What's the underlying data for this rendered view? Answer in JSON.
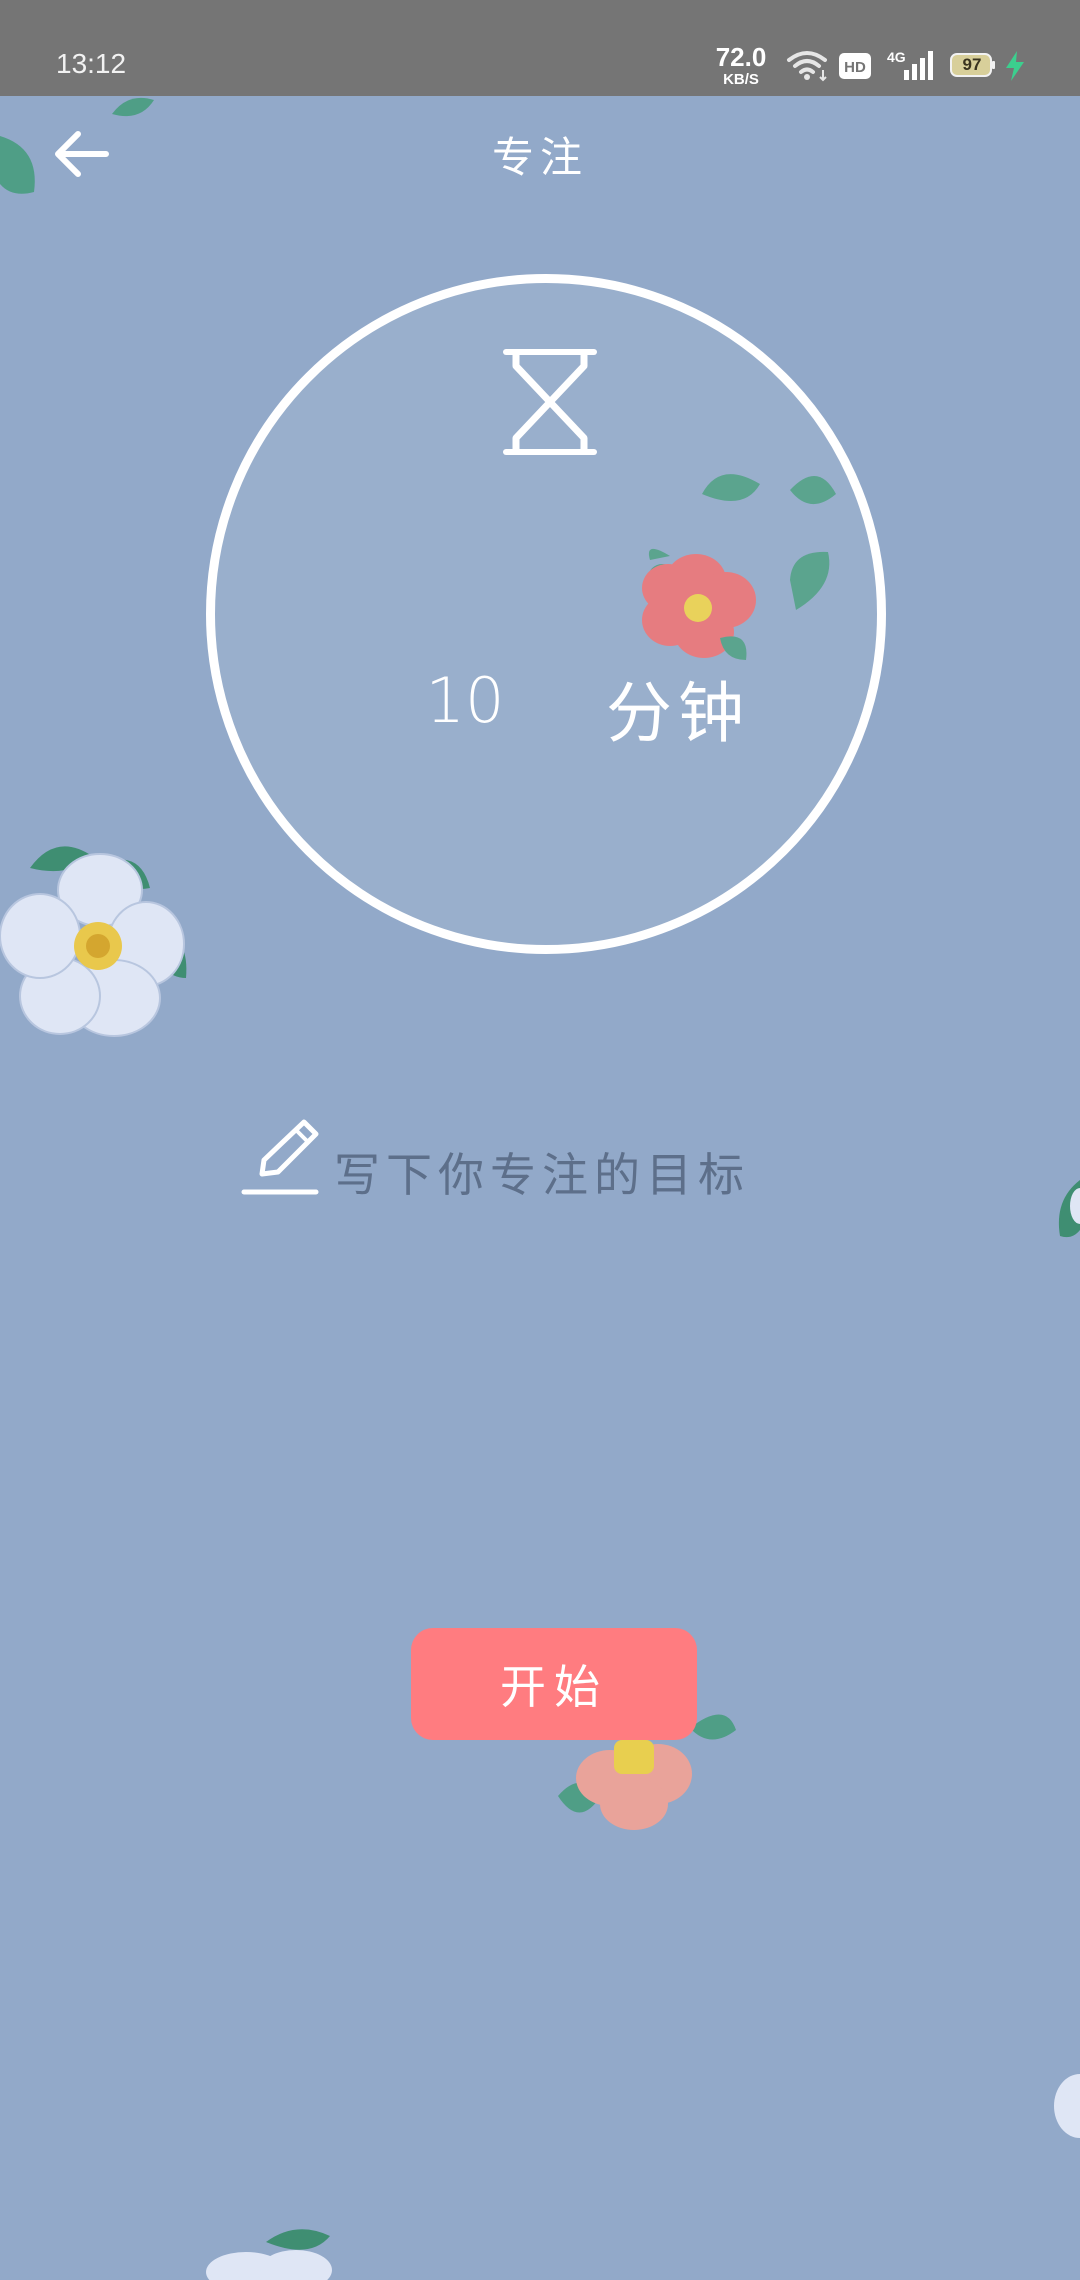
{
  "status_bar": {
    "time": "13:12",
    "net_speed_value": "72.0",
    "net_speed_unit": "KB/S",
    "hd_label": "HD",
    "network_type": "4G",
    "battery_level": "97"
  },
  "header": {
    "title": "专注"
  },
  "timer": {
    "value": "10",
    "unit": "分钟"
  },
  "goal": {
    "placeholder": "写下你专注的目标"
  },
  "start_button": {
    "label": "开始",
    "color": "#ff7c80"
  },
  "theme": {
    "background": "#92a9c9",
    "status_bar": "#757575"
  },
  "icons": [
    "back-arrow-icon",
    "hourglass-icon",
    "pencil-icon",
    "wifi-icon",
    "hd-icon",
    "signal-icon",
    "battery-icon",
    "charging-icon"
  ]
}
